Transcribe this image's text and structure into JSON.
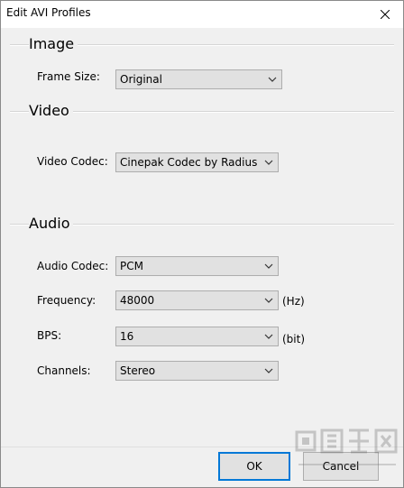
{
  "window": {
    "title": "Edit AVI Profiles"
  },
  "image": {
    "section_title": "Image",
    "frame_size": {
      "label": "Frame Size:",
      "value": "Original"
    }
  },
  "video": {
    "section_title": "Video",
    "codec": {
      "label": "Video Codec:",
      "value": "Cinepak Codec by Radius"
    }
  },
  "audio": {
    "section_title": "Audio",
    "codec": {
      "label": "Audio Codec:",
      "value": "PCM"
    },
    "frequency": {
      "label": "Frequency:",
      "value": "48000",
      "unit": "(Hz)"
    },
    "bps": {
      "label": "BPS:",
      "value": "16",
      "unit": "(bit)"
    },
    "channels": {
      "label": "Channels:",
      "value": "Stereo"
    }
  },
  "buttons": {
    "ok": "OK",
    "cancel": "Cancel"
  },
  "colors": {
    "dialog_bg": "#f0f0f0",
    "default_button_border": "#0078d7",
    "combo_bg": "#e1e1e1"
  },
  "icons": {
    "close": "close-icon",
    "dropdown": "chevron-down-icon"
  }
}
